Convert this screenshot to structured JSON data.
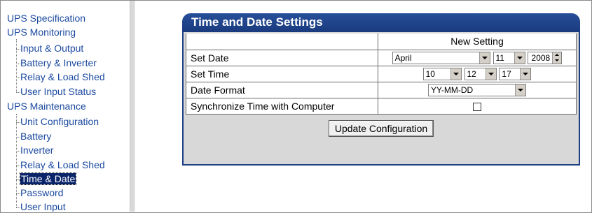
{
  "nav": {
    "sections": [
      {
        "label": "UPS Specification",
        "items": []
      },
      {
        "label": "UPS Monitoring",
        "items": [
          "Input & Output",
          "Battery & Inverter",
          "Relay & Load Shed",
          "User Input Status"
        ]
      },
      {
        "label": "UPS Maintenance",
        "items": [
          "Unit Configuration",
          "Battery",
          "Inverter",
          "Relay & Load Shed",
          "Time & Date",
          "Password",
          "User Input"
        ]
      }
    ],
    "selected": "Time & Date"
  },
  "panel": {
    "title": "Time and Date Settings",
    "column_header": "New Setting",
    "rows": {
      "set_date": {
        "label": "Set Date",
        "month": "April",
        "day": "11",
        "year": "2008"
      },
      "set_time": {
        "label": "Set Time",
        "hour": "10",
        "minute": "12",
        "second": "17"
      },
      "date_format": {
        "label": "Date Format",
        "value": "YY-MM-DD"
      },
      "sync": {
        "label": "Synchronize Time with Computer",
        "checked": false
      }
    },
    "update_button": "Update Configuration"
  },
  "colors": {
    "nav_link": "#1c4aa0",
    "title_bar": "#1a3a7d",
    "selected_bg": "#0a246a"
  }
}
